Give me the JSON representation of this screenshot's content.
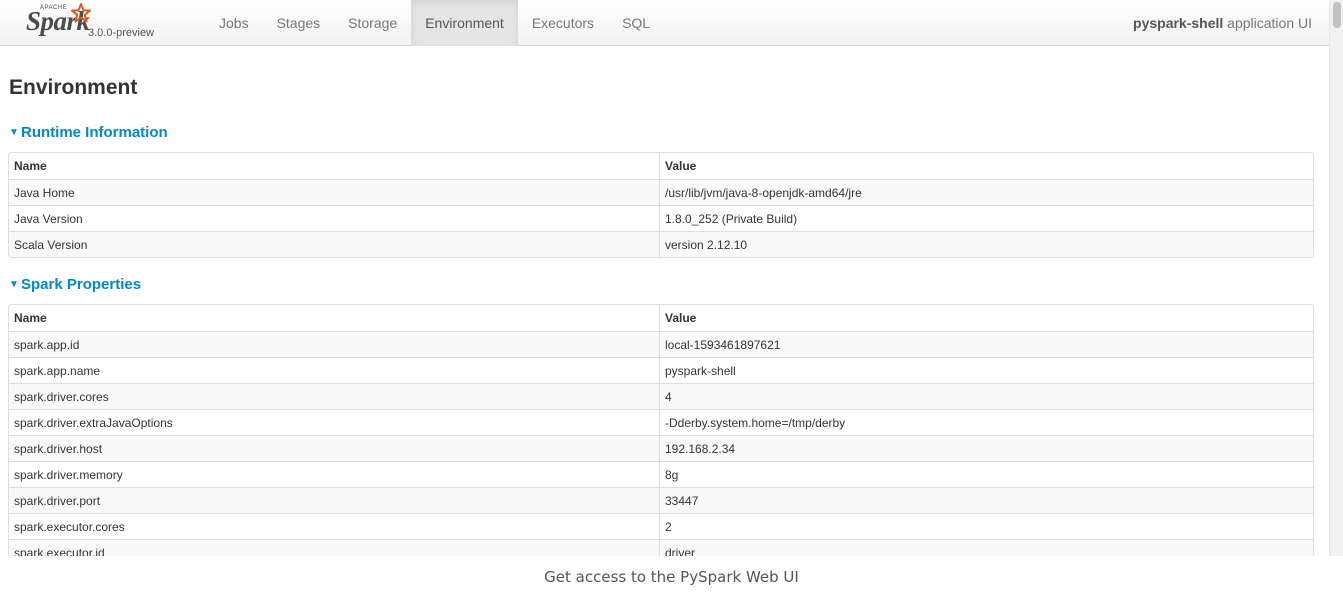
{
  "brand": {
    "apache": "APACHE",
    "name": "Spark",
    "version": "3.0.0-preview"
  },
  "nav": {
    "tabs": [
      {
        "label": "Jobs",
        "active": false
      },
      {
        "label": "Stages",
        "active": false
      },
      {
        "label": "Storage",
        "active": false
      },
      {
        "label": "Environment",
        "active": true
      },
      {
        "label": "Executors",
        "active": false
      },
      {
        "label": "SQL",
        "active": false
      }
    ],
    "app_name": "pyspark-shell",
    "app_suffix": " application UI"
  },
  "page": {
    "title": "Environment"
  },
  "runtime": {
    "heading": "Runtime Information",
    "col_name": "Name",
    "col_value": "Value",
    "rows": [
      {
        "name": "Java Home",
        "value": "/usr/lib/jvm/java-8-openjdk-amd64/jre"
      },
      {
        "name": "Java Version",
        "value": "1.8.0_252 (Private Build)"
      },
      {
        "name": "Scala Version",
        "value": "version 2.12.10"
      }
    ]
  },
  "spark_properties": {
    "heading": "Spark Properties",
    "col_name": "Name",
    "col_value": "Value",
    "rows": [
      {
        "name": "spark.app.id",
        "value": "local-1593461897621"
      },
      {
        "name": "spark.app.name",
        "value": "pyspark-shell"
      },
      {
        "name": "spark.driver.cores",
        "value": "4"
      },
      {
        "name": "spark.driver.extraJavaOptions",
        "value": "-Dderby.system.home=/tmp/derby"
      },
      {
        "name": "spark.driver.host",
        "value": "192.168.2.34"
      },
      {
        "name": "spark.driver.memory",
        "value": "8g"
      },
      {
        "name": "spark.driver.port",
        "value": "33447"
      },
      {
        "name": "spark.executor.cores",
        "value": "2"
      },
      {
        "name": "spark.executor.id",
        "value": "driver"
      }
    ]
  },
  "caption": "Get access to the PySpark Web UI",
  "colors": {
    "link": "#0088cc",
    "stripe": "#f9f9f9",
    "border": "#dddddd"
  }
}
